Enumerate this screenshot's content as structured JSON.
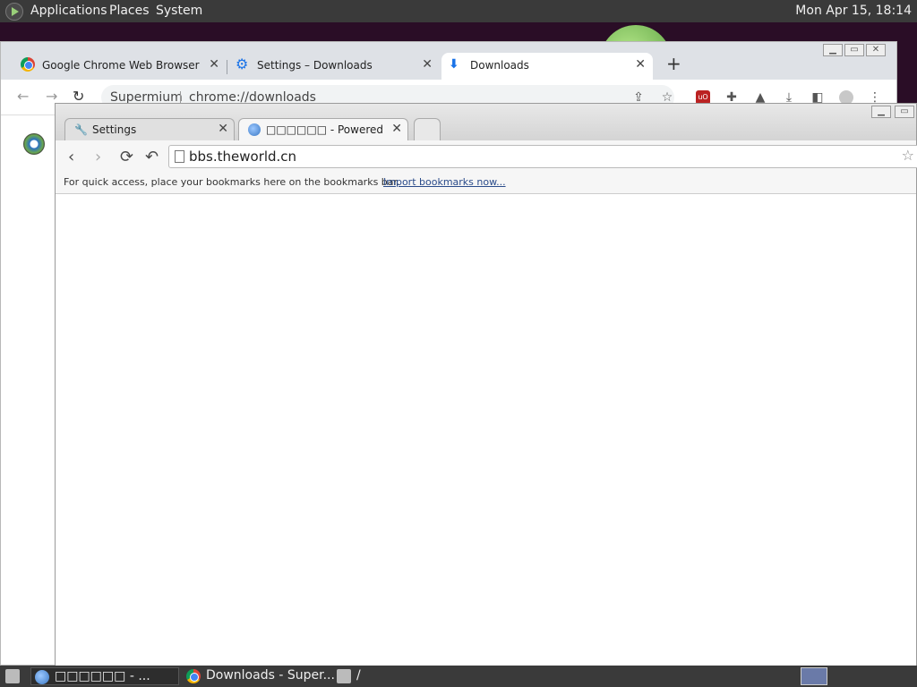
{
  "top_panel": {
    "menus": [
      "Applications",
      "Places",
      "System"
    ],
    "clock": "Mon Apr 15, 18:14"
  },
  "back_window": {
    "tabs": [
      {
        "label": "Google Chrome Web Browser",
        "icon": "chrome-icon"
      },
      {
        "label": "Settings – Downloads",
        "icon": "gear-icon"
      },
      {
        "label": "Downloads",
        "icon": "download-icon"
      }
    ],
    "new_tab": "+",
    "omnibox": {
      "app_name": "Supermium",
      "url": "chrome://downloads"
    },
    "colors": {
      "tabstrip": "#dee1e6",
      "accent": "#1a73e8"
    }
  },
  "front_window": {
    "tabs": [
      {
        "label": "Settings",
        "icon": "wrench-icon"
      },
      {
        "label": "□□□□□□ - Powered by Discuz!",
        "icon": "globe-icon"
      }
    ],
    "omnibox": {
      "url": "bbs.theworld.cn"
    },
    "bookmarks_bar": {
      "message": "For quick access, place your bookmarks here on the bookmarks bar.",
      "link": "Import bookmarks now..."
    }
  },
  "bottom_panel": {
    "tasks": [
      {
        "label": "□□□□□□ - ...",
        "icon": "globe-icon"
      },
      {
        "label": "Downloads - Super...",
        "icon": "chrome-icon"
      },
      {
        "label": "/",
        "icon": "folder-icon"
      }
    ]
  }
}
